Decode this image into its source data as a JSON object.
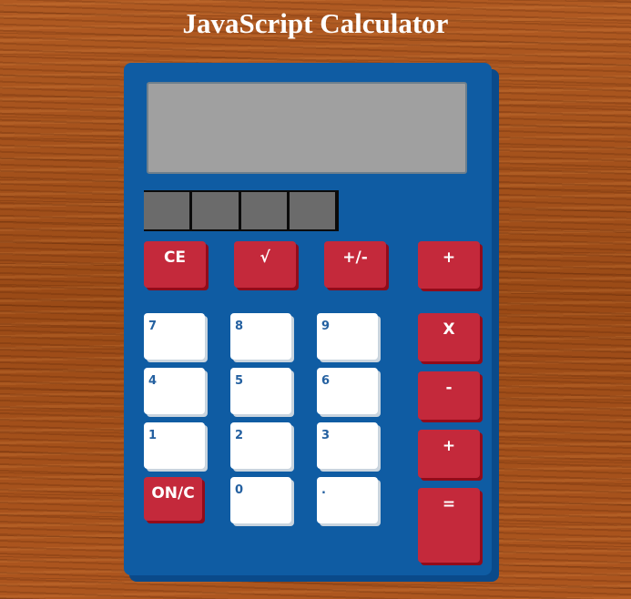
{
  "page": {
    "title": "JavaScript Calculator"
  },
  "calculator": {
    "display": {
      "value": ""
    },
    "keys": {
      "ce": "CE",
      "sqrt": "√",
      "plusminus": "+/-",
      "divide": "+",
      "multiply": "X",
      "subtract": "-",
      "add": "+",
      "equals": "=",
      "onc": "ON/C",
      "d7": "7",
      "d8": "8",
      "d9": "9",
      "d4": "4",
      "d5": "5",
      "d6": "6",
      "d1": "1",
      "d2": "2",
      "d3": "3",
      "d0": "0",
      "decimal": "."
    }
  },
  "colors": {
    "body": "#0f5ca3",
    "display": "#a0a0a0",
    "operator_key": "#c4293b",
    "digit_key": "#ffffff",
    "digit_text": "#2460a0"
  }
}
